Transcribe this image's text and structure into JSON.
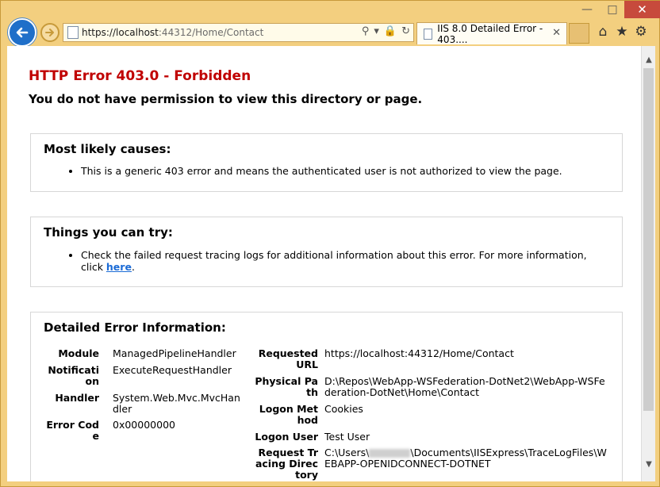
{
  "browser": {
    "url_main": "https://localhost",
    "url_rest": ":44312/Home/Contact",
    "tab_title": "IIS 8.0 Detailed Error - 403....",
    "icons": {
      "back": "back-arrow-icon",
      "forward": "forward-arrow-icon",
      "search": "search-icon",
      "lock": "lock-icon",
      "refresh": "refresh-icon",
      "home": "home-icon",
      "favorites": "star-icon",
      "tools": "gear-icon"
    }
  },
  "page": {
    "title": "HTTP Error 403.0 - Forbidden",
    "subtitle": "You do not have permission to view this directory or page.",
    "causes": {
      "heading": "Most likely causes:",
      "items": [
        "This is a generic 403 error and means the authenticated user is not authorized to view the page."
      ]
    },
    "try": {
      "heading": "Things you can try:",
      "text": "Check the failed request tracing logs for additional information about this error. For more information, click ",
      "link": "here",
      "tail": "."
    },
    "details": {
      "heading": "Detailed Error Information:",
      "module_label": "Module",
      "module_value": "ManagedPipelineHandler",
      "notification_label": "Notification",
      "notification_value": "ExecuteRequestHandler",
      "handler_label": "Handler",
      "handler_value": "System.Web.Mvc.MvcHandler",
      "error_code_label": "Error Code",
      "error_code_value": "0x00000000",
      "requested_url_label": "Requested URL",
      "requested_url_value": "https://localhost:44312/Home/Contact",
      "physical_path_label": "Physical Path",
      "physical_path_value": "D:\\Repos\\WebApp-WSFederation-DotNet2\\WebApp-WSFederation-DotNet\\Home\\Contact",
      "logon_method_label": "Logon Method",
      "logon_method_value": "Cookies",
      "logon_user_label": "Logon User",
      "logon_user_value": "Test User",
      "tracing_label": "Request Tracing Directory",
      "tracing_prefix": "C:\\Users\\",
      "tracing_suffix": "\\Documents\\IISExpress\\TraceLogFiles\\WEBAPP-OPENIDCONNECT-DOTNET"
    }
  },
  "colors": {
    "frame": "#f3cf7f",
    "error_title": "#c00000",
    "link": "#1b6bd6",
    "back_button": "#1f6fc9"
  }
}
